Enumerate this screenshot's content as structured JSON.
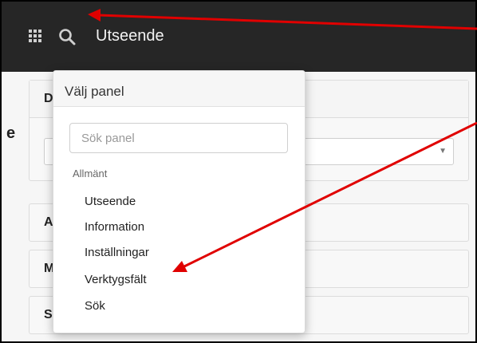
{
  "header": {
    "title": "Utseende",
    "apps_icon": "grid-icon",
    "search_icon": "search-icon"
  },
  "panels": [
    {
      "letter": "D"
    },
    {
      "letter": "A"
    },
    {
      "letter": "M"
    },
    {
      "letter": "S"
    }
  ],
  "side_fragment": "e",
  "dropdown": {
    "title": "Välj panel",
    "search_placeholder": "Sök panel",
    "group_label": "Allmänt",
    "items": [
      "Utseende",
      "Information",
      "Inställningar",
      "Verktygsfält",
      "Sök"
    ]
  },
  "colors": {
    "topbar": "#262626",
    "annotation_arrow": "#e00000"
  }
}
